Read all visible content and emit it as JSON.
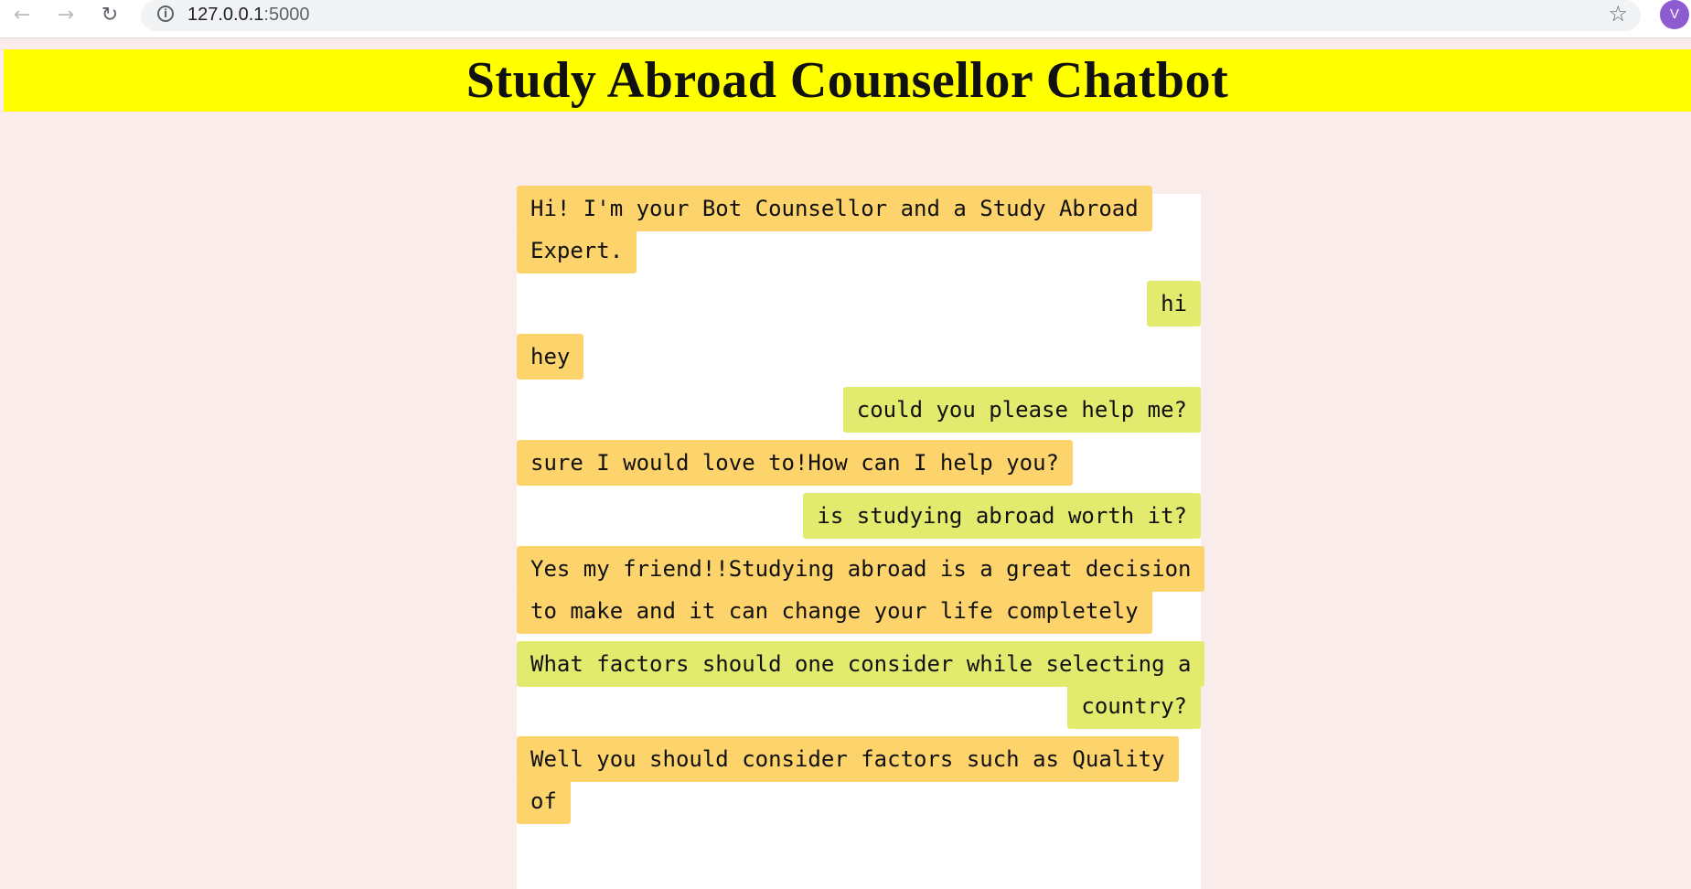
{
  "browser": {
    "back_icon": "←",
    "forward_icon": "→",
    "reload_icon": "↻",
    "info_icon": "i",
    "url_host": "127.0.0.1",
    "url_port": ":5000",
    "star_icon": "☆",
    "profile_initial": "V"
  },
  "header": {
    "title": "Study Abroad Counsellor Chatbot"
  },
  "chat": {
    "messages": [
      {
        "sender": "bot",
        "text": "Hi! I'm your Bot Counsellor and a Study Abroad Expert."
      },
      {
        "sender": "user",
        "text": "hi"
      },
      {
        "sender": "bot",
        "text": "hey"
      },
      {
        "sender": "user",
        "text": "could you please help me?"
      },
      {
        "sender": "bot",
        "text": "sure I would love to!How can I help you?"
      },
      {
        "sender": "user",
        "text": "is studying abroad worth it?"
      },
      {
        "sender": "bot",
        "text": "Yes my friend!!Studying abroad is a great decision to make and it can change your life completely"
      },
      {
        "sender": "user",
        "text": "What factors should one consider while selecting a country?"
      },
      {
        "sender": "bot",
        "text": "Well you should consider factors such as Quality of"
      }
    ]
  },
  "colors": {
    "page_background": "#f9ecea",
    "header_background": "#ffff00",
    "bot_bubble": "#fdd36c",
    "user_bubble": "#e3eb6e",
    "chat_panel": "#ffffff"
  }
}
